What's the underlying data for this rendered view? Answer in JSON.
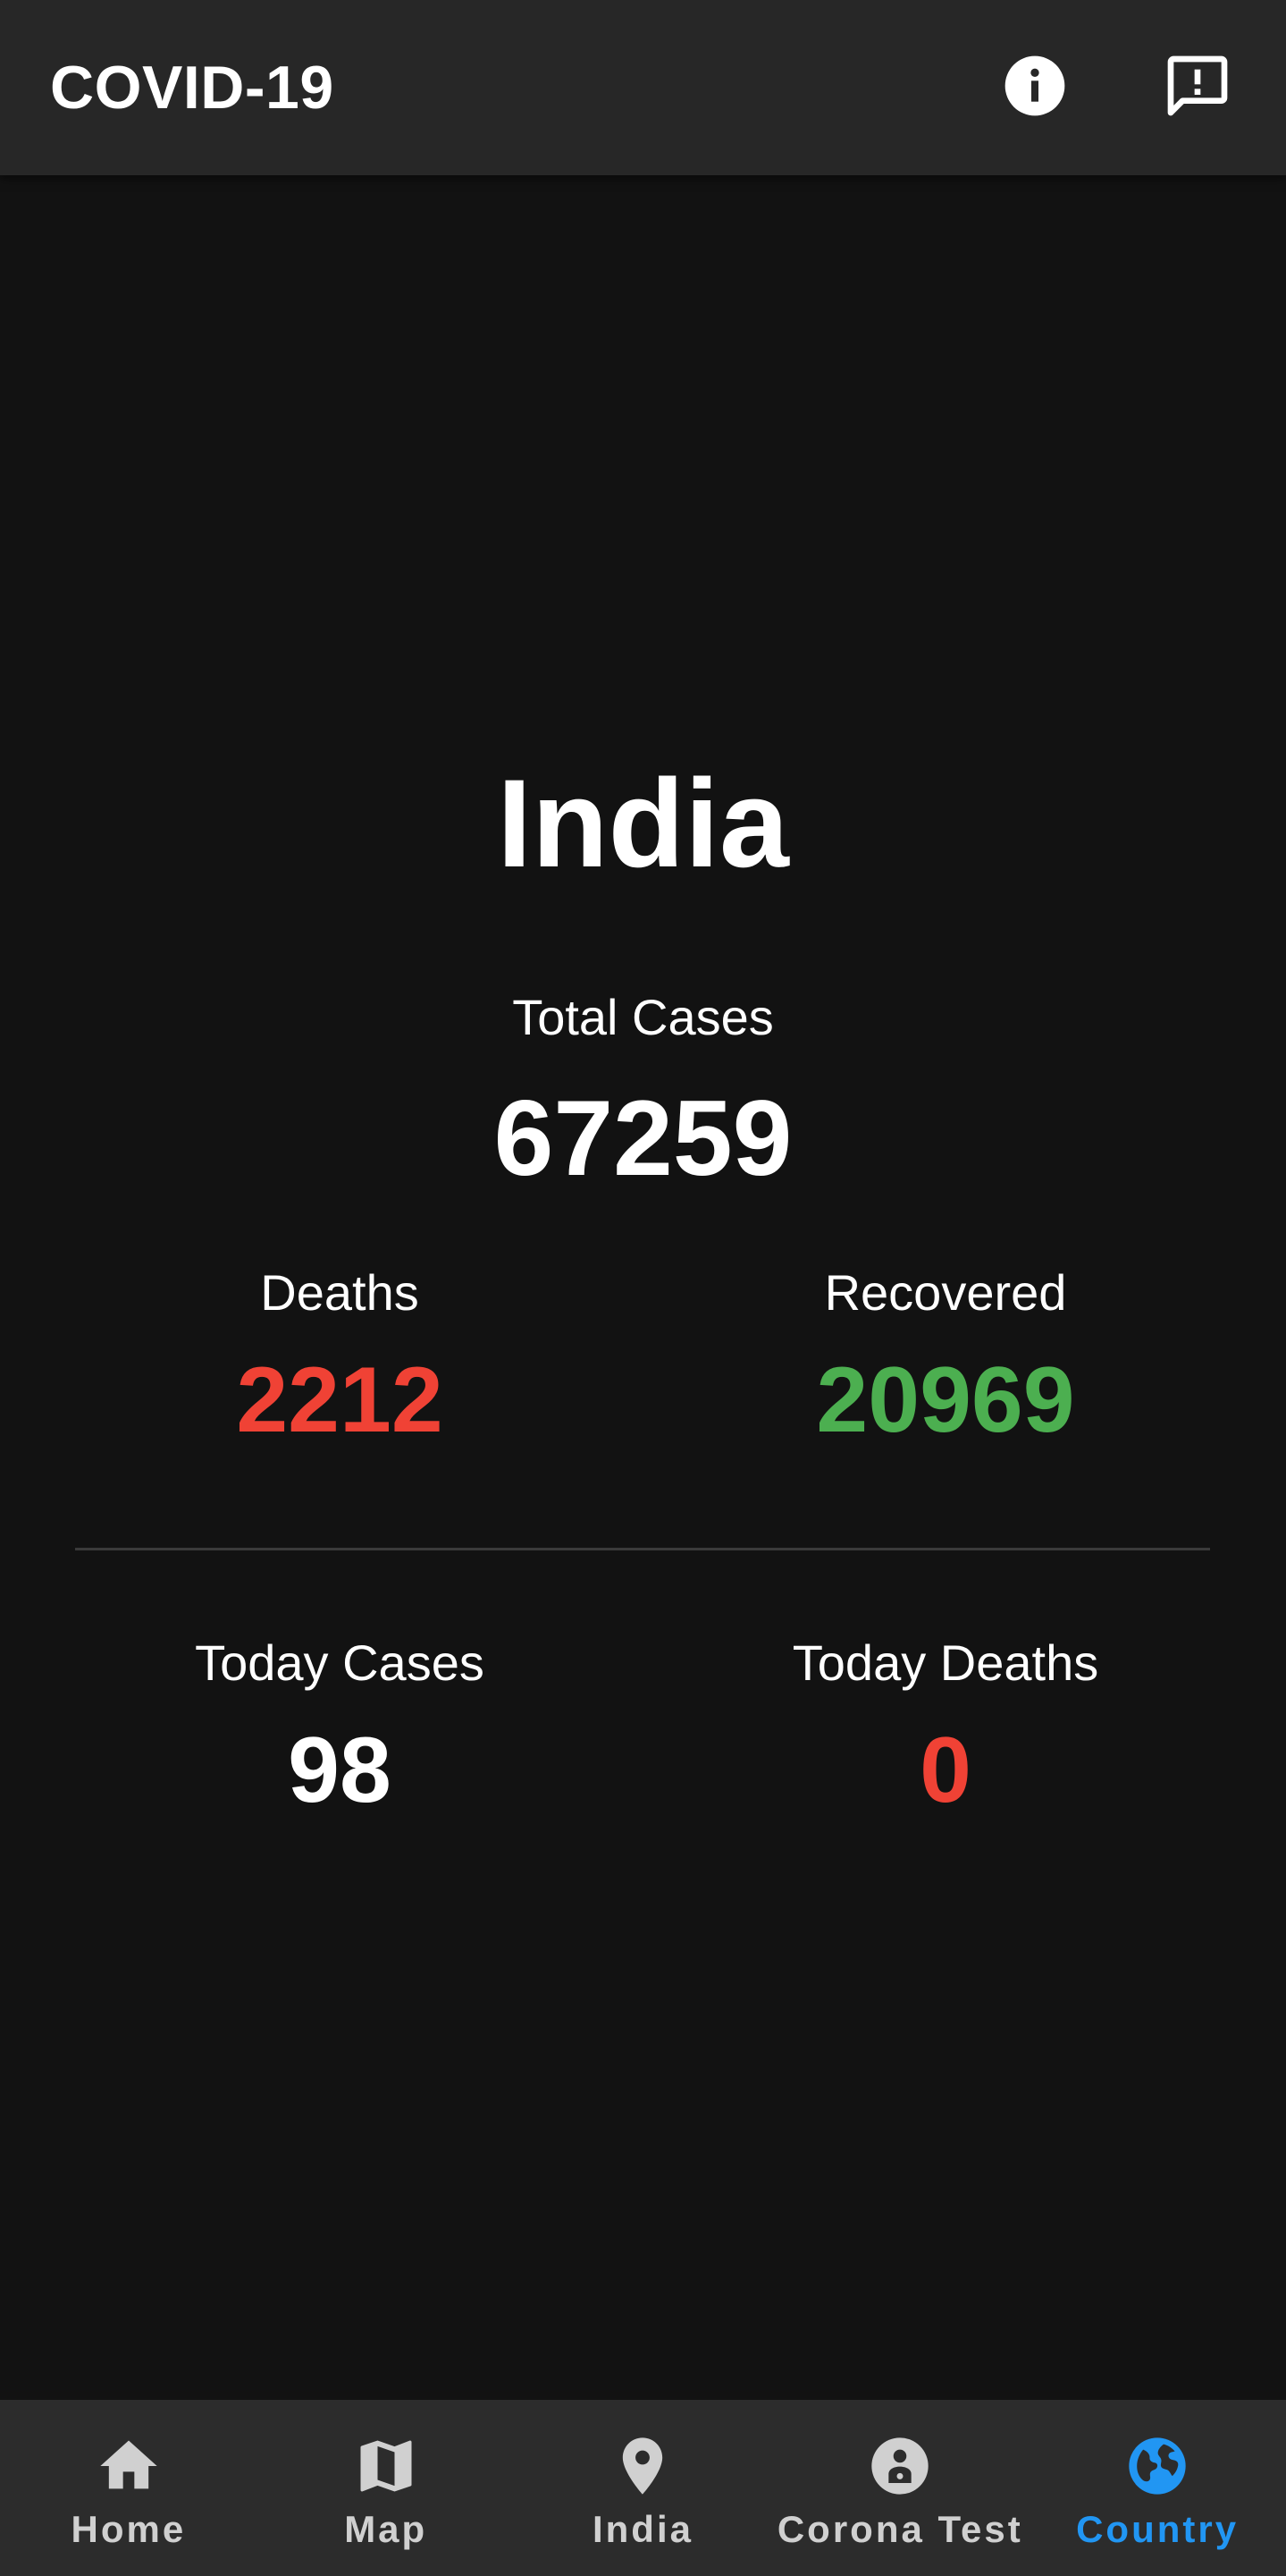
{
  "appbar": {
    "title": "COVID-19",
    "info_icon": "info-icon",
    "feedback_icon": "feedback-icon"
  },
  "country": {
    "name": "India",
    "total_cases_label": "Total Cases",
    "total_cases": "67259",
    "deaths_label": "Deaths",
    "deaths": "2212",
    "recovered_label": "Recovered",
    "recovered": "20969",
    "today_cases_label": "Today Cases",
    "today_cases": "98",
    "today_deaths_label": "Today Deaths",
    "today_deaths": "0"
  },
  "colors": {
    "background": "#121212",
    "appbar": "#272727",
    "deaths": "#f04235",
    "recovered": "#4caf50",
    "active_nav": "#2196f3",
    "inactive_nav": "#d0d0d0"
  },
  "bottom_nav": {
    "items": [
      {
        "label": "Home",
        "icon": "home-icon",
        "active": false
      },
      {
        "label": "Map",
        "icon": "map-icon",
        "active": false
      },
      {
        "label": "India",
        "icon": "location-pin-icon",
        "active": false
      },
      {
        "label": "Corona Test",
        "icon": "person-test-icon",
        "active": false
      },
      {
        "label": "Country",
        "icon": "globe-icon",
        "active": true
      }
    ]
  }
}
